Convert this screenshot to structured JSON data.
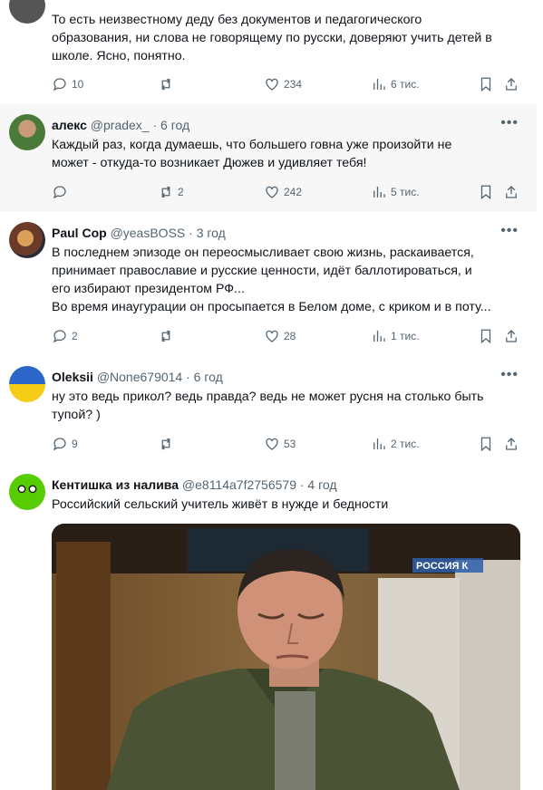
{
  "tweets": [
    {
      "text_lines": [
        "То есть неизвестному деду без документов и педагогического",
        "образования, ни слова не говорящему по русски, доверяют учить детей в",
        "школе. Ясно, понятно."
      ],
      "stats": {
        "replies": "10",
        "retweets": "",
        "likes": "234",
        "views": "6 тис."
      }
    },
    {
      "name": "алекс",
      "handle": "@pradex_",
      "time": "· 6 год",
      "text_lines": [
        "Каждый раз, когда думаешь, что большего говна уже произойти не",
        "может - откуда-то возникает Дюжев и удивляет тебя!"
      ],
      "stats": {
        "replies": "",
        "retweets": "2",
        "likes": "242",
        "views": "5 тис."
      }
    },
    {
      "name": "Paul Cop",
      "handle": "@yeasBOSS",
      "time": "· 3 год",
      "text_lines": [
        "В последнем эпизоде он переосмысливает свою жизнь, раскаивается,",
        "принимает православие и русские ценности, идёт баллотироваться, и",
        "его избирают президентом РФ...",
        "Во время инаугурации он просыпается в Белом доме, с криком и в поту..."
      ],
      "stats": {
        "replies": "2",
        "retweets": "",
        "likes": "28",
        "views": "1 тис."
      }
    },
    {
      "name": "Oleksii",
      "handle": "@None679014",
      "time": "· 6 год",
      "text_lines": [
        "ну это ведь прикол? ведь правда? ведь не может русня на столько быть",
        "тупой? )"
      ],
      "stats": {
        "replies": "9",
        "retweets": "",
        "likes": "53",
        "views": "2 тис."
      }
    },
    {
      "name": "Кентишка из налива",
      "handle": "@e8114a7f2756579",
      "time": "· 4 год",
      "text_lines": [
        "Российский сельский учитель живёт в нужде и бедности"
      ],
      "media_watermark": "РОССИЯ К"
    }
  ],
  "colors": {
    "text": "#0f1419",
    "muted": "#536471",
    "divider": "#eff3f4"
  },
  "icons": [
    "reply-icon",
    "retweet-icon",
    "like-icon",
    "views-icon",
    "bookmark-icon",
    "share-icon",
    "more-icon"
  ]
}
